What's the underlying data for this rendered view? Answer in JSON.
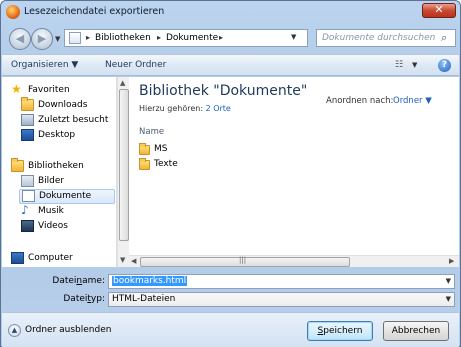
{
  "window": {
    "title": "Lesezeichendatei exportieren",
    "close_glyph": "✕"
  },
  "address": {
    "crumbs": [
      "Bibliotheken",
      "Dokumente"
    ],
    "search_placeholder": "Dokumente durchsuchen"
  },
  "toolbar": {
    "organize": "Organisieren ▼",
    "new_folder": "Neuer Ordner",
    "help_glyph": "?"
  },
  "sidebar": {
    "favorites_label": "Favoriten",
    "favorites": [
      "Downloads",
      "Zuletzt besucht",
      "Desktop"
    ],
    "libraries_label": "Bibliotheken",
    "libraries": [
      "Bilder",
      "Dokumente",
      "Musik",
      "Videos"
    ],
    "computer_label": "Computer"
  },
  "content": {
    "title": "Bibliothek \"Dokumente\"",
    "includes_label": "Hierzu gehören:",
    "includes_link": "2 Orte",
    "arrange_label": "Anordnen nach:",
    "arrange_value": "Ordner ▼",
    "column_name": "Name",
    "items": [
      "MS",
      "Texte"
    ]
  },
  "form": {
    "filename_label_pre": "Datei",
    "filename_label_u": "n",
    "filename_label_post": "ame:",
    "filename_value": "bookmarks.html",
    "filetype_label_pre": "Datei",
    "filetype_label_u": "t",
    "filetype_label_post": "yp:",
    "filetype_value": "HTML-Dateien"
  },
  "footer": {
    "hide_folders": "Ordner ausblenden",
    "save_u": "S",
    "save_rest": "peichern",
    "cancel": "Abbrechen"
  }
}
